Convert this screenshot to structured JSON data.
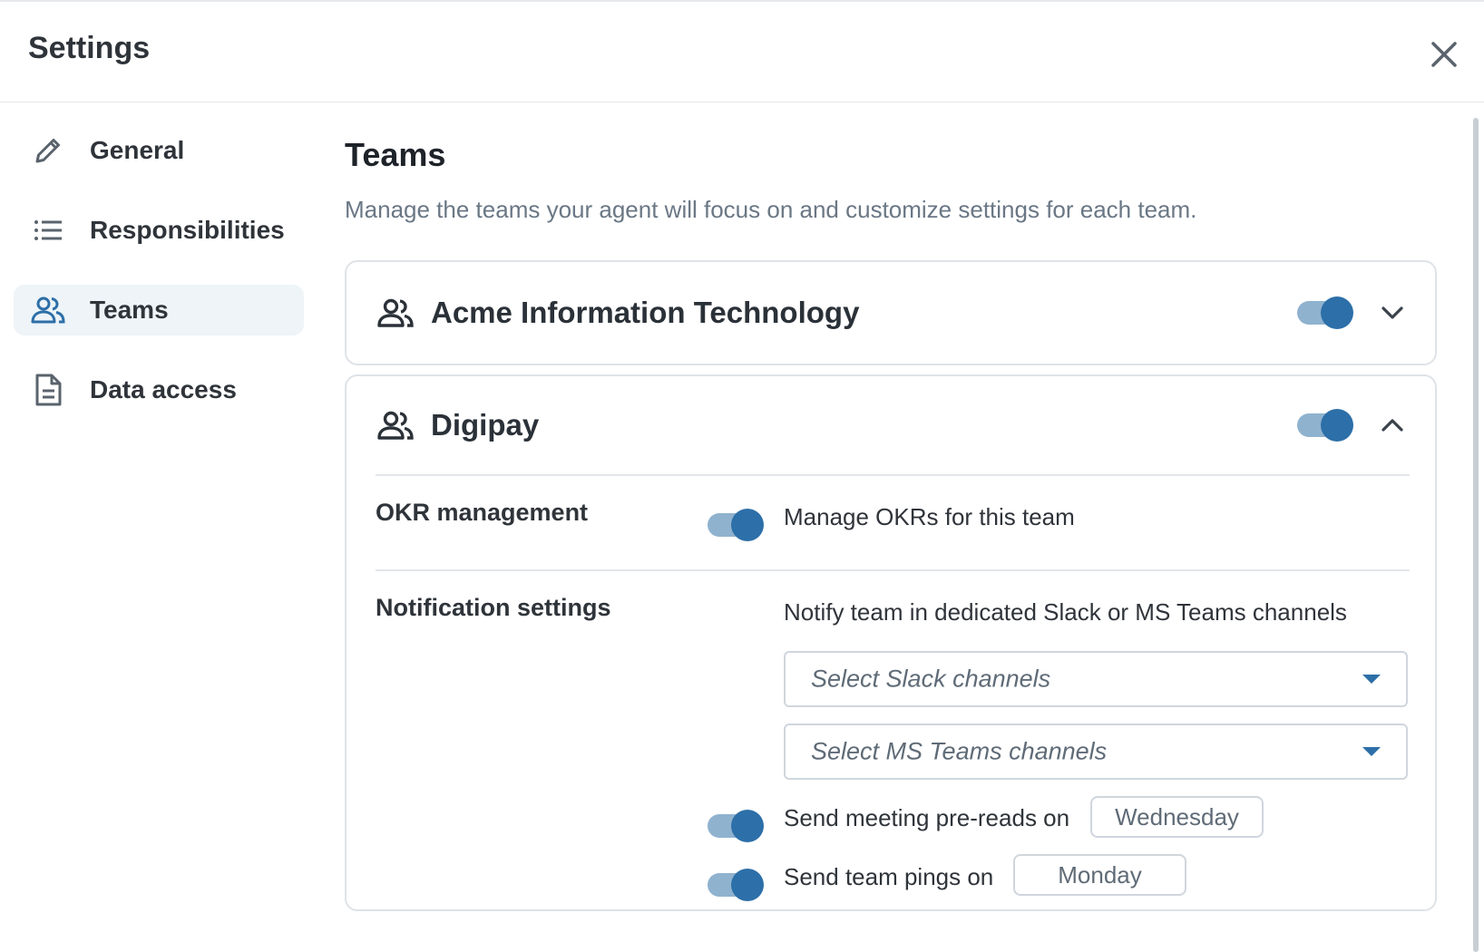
{
  "header": {
    "title": "Settings"
  },
  "sidebar": {
    "items": [
      {
        "label": "General",
        "icon": "pencil-icon",
        "active": false
      },
      {
        "label": "Responsibilities",
        "icon": "list-icon",
        "active": false
      },
      {
        "label": "Teams",
        "icon": "people-icon",
        "active": true
      },
      {
        "label": "Data access",
        "icon": "document-icon",
        "active": false
      }
    ]
  },
  "main": {
    "title": "Teams",
    "description": "Manage the teams your agent will focus on and customize settings for each team."
  },
  "teams": [
    {
      "name": "Acme Information Technology",
      "enabled": true,
      "expanded": false
    },
    {
      "name": "Digipay",
      "enabled": true,
      "expanded": true,
      "okr": {
        "label": "OKR management",
        "toggle_text": "Manage OKRs for this team",
        "enabled": true
      },
      "notifications": {
        "label": "Notification settings",
        "channels_text": "Notify team in dedicated Slack or MS Teams channels",
        "slack_placeholder": "Select Slack channels",
        "msteams_placeholder": "Select MS Teams channels",
        "preread_text": "Send meeting pre-reads on",
        "preread_day": "Wednesday",
        "preread_enabled": true,
        "ping_text": "Send team pings on",
        "ping_day": "Monday",
        "ping_enabled": true
      }
    }
  ],
  "colors": {
    "accent": "#2d6fa8",
    "toggle_track": "#8fb2cf",
    "active_bg": "#eef4f8"
  }
}
